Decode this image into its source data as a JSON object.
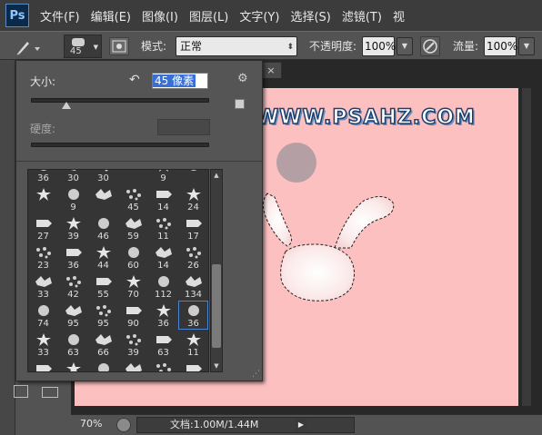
{
  "app": {
    "logo": "Ps"
  },
  "menu": [
    "文件(F)",
    "编辑(E)",
    "图像(I)",
    "图层(L)",
    "文字(Y)",
    "选择(S)",
    "滤镜(T)",
    "视"
  ],
  "options_bar": {
    "brush_size_value": "45",
    "mode_label": "模式:",
    "mode_value": "正常",
    "opacity_label": "不透明度:",
    "opacity_value": "100%",
    "flow_label": "流量:",
    "flow_value": "100%"
  },
  "document": {
    "tab_close": "×",
    "watermark": "WWW.PSAHZ.COM",
    "canvas_color": "#fcc0c0"
  },
  "status_bar": {
    "zoom": "70%",
    "doc_info": "文档:1.00M/1.44M"
  },
  "brush_picker": {
    "size_label": "大小:",
    "size_value": "45 像素",
    "size_level": 0.2,
    "hardness_label": "硬度:",
    "brush_numbers": [
      "36",
      "30",
      "30",
      "",
      "9",
      "",
      "",
      "9",
      "",
      "45",
      "14",
      "24",
      "27",
      "39",
      "46",
      "59",
      "11",
      "17",
      "23",
      "36",
      "44",
      "60",
      "14",
      "26",
      "33",
      "42",
      "55",
      "70",
      "112",
      "134",
      "74",
      "95",
      "95",
      "90",
      "36",
      "36",
      "33",
      "63",
      "66",
      "39",
      "63",
      "11",
      "",
      "",
      "",
      "",
      "",
      ""
    ],
    "selected_index": 35
  }
}
